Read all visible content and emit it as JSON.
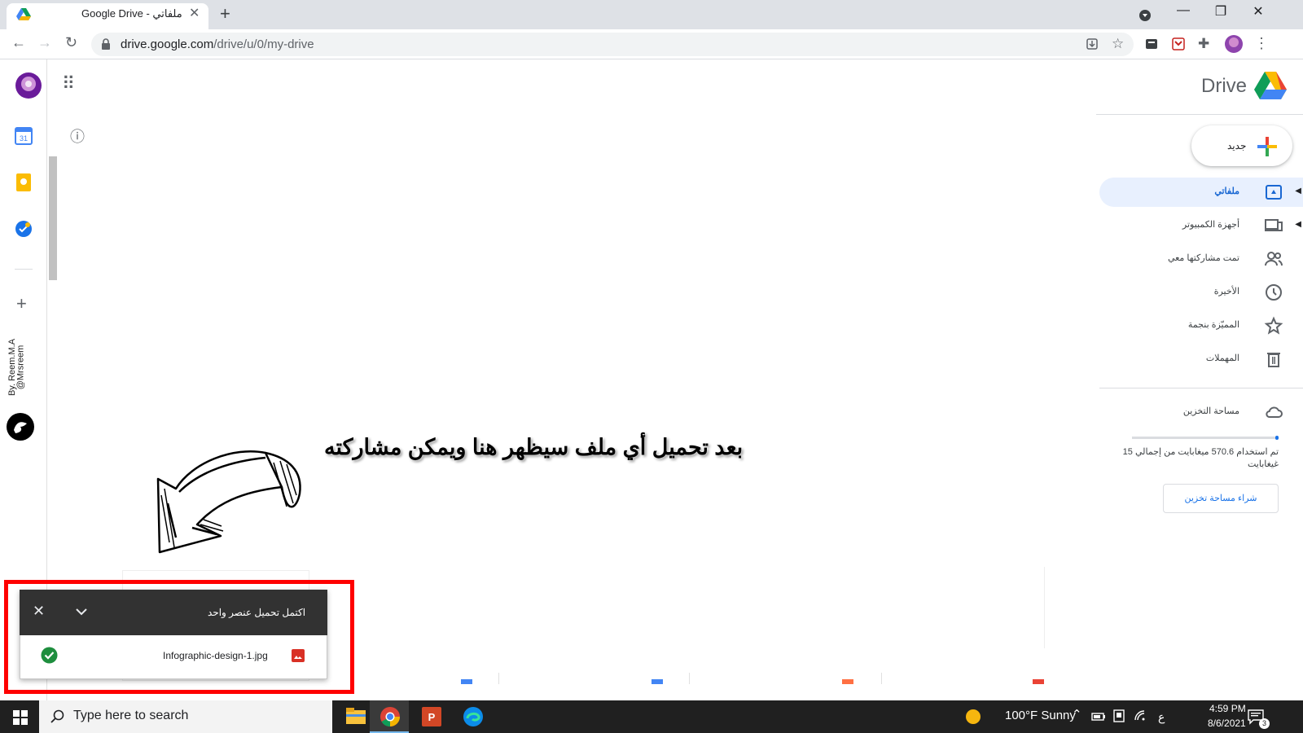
{
  "browser": {
    "tab_title": "Google Drive - ملفاتي",
    "url_host": "drive.google.com",
    "url_path": "/drive/u/0/my-drive"
  },
  "drive": {
    "title": "Drive",
    "new_button_label": "جديد",
    "nav": [
      {
        "label": "ملفاتي",
        "icon": "my-drive-icon",
        "active": true
      },
      {
        "label": "أجهزة الكمبيوتر",
        "icon": "computers-icon"
      },
      {
        "label": "تمت مشاركتها معي",
        "icon": "shared-icon"
      },
      {
        "label": "الأخيرة",
        "icon": "clock-icon"
      },
      {
        "label": "المميّزة بنجمة",
        "icon": "star-icon"
      },
      {
        "label": "المهملات",
        "icon": "trash-icon"
      }
    ],
    "storage_label": "مساحة التخزين",
    "storage_text": "تم استخدام 570.6 ميغابايت من إجمالي 15 غيغابايت",
    "buy_storage": "شراء مساحة تخزين"
  },
  "annotation": {
    "text": "بعد تحميل أي ملف سيظهر هنا ويمكن مشاركته",
    "credit_name": "By. Reem.M.A",
    "credit_handle": "@Mrsreem"
  },
  "upload_popup": {
    "title": "اكتمل تحميل عنصر واحد",
    "filename": "Infographic-design-1.jpg",
    "status_icon": "check-circle-icon",
    "file_type_icon": "image-icon"
  },
  "taskbar": {
    "search_placeholder": "Type here to search",
    "weather": "100°F  Sunny",
    "time": "4:59 PM",
    "date": "8/6/2021",
    "notification_count": "3",
    "lang": "ع"
  },
  "colors": {
    "drive_blue": "#1a73e8",
    "active_nav_bg": "#e8f0fe",
    "highlight_red": "#ff0000",
    "popup_header": "#323232",
    "success_green": "#1e8e3e"
  }
}
